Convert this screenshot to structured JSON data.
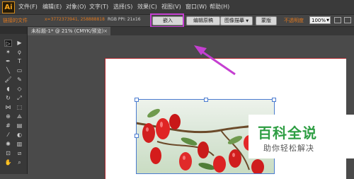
{
  "app": {
    "logo": "Ai"
  },
  "menu": [
    "文件(F)",
    "编辑(E)",
    "对象(O)",
    "文字(T)",
    "选择(S)",
    "效果(C)",
    "视图(V)",
    "窗口(W)",
    "帮助(H)"
  ],
  "control_bar": {
    "linked_file_label": "链接的文件",
    "coords": "x=3772373941, 258888818",
    "format": "RGB PPI: 21x16",
    "embed_button": "嵌入",
    "edit_original_button": "编辑原稿",
    "image_trace_button": "图像描摹",
    "mask_button": "蒙版",
    "opacity_label": "不透明度",
    "opacity_value": "100%"
  },
  "document_tab": {
    "title": "未标题-1* @ 21% (CMYK/预览)",
    "close": "×"
  },
  "watermark": {
    "title": "百科全说",
    "subtitle": "助你轻松解决"
  },
  "colors": {
    "highlight": "#c53fd1",
    "accent_orange": "#e0781e",
    "artboard_border": "#b0262c",
    "watermark_green": "#2e9e43"
  },
  "tools": [
    "selection-tool",
    "direct-selection-tool",
    "magic-wand-tool",
    "lasso-tool",
    "pen-tool",
    "type-tool",
    "line-tool",
    "rectangle-tool",
    "paintbrush-tool",
    "pencil-tool",
    "blob-brush-tool",
    "eraser-tool",
    "rotate-tool",
    "scale-tool",
    "width-tool",
    "free-transform-tool",
    "shape-builder-tool",
    "perspective-tool",
    "mesh-tool",
    "gradient-tool",
    "eyedropper-tool",
    "blend-tool",
    "symbol-sprayer-tool",
    "column-graph-tool",
    "artboard-tool",
    "slice-tool",
    "hand-tool",
    "zoom-tool"
  ]
}
